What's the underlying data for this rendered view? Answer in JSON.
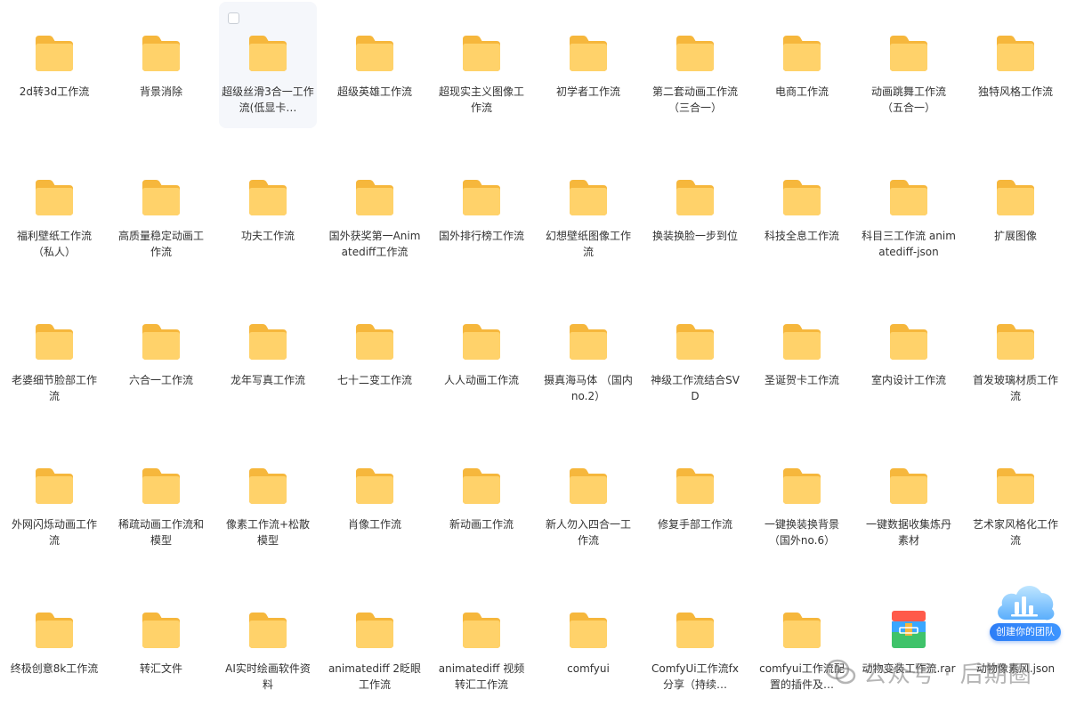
{
  "items": [
    {
      "name": "2d转3d工作流",
      "type": "folder"
    },
    {
      "name": "背景消除",
      "type": "folder"
    },
    {
      "name": "超级丝滑3合一工作流(低显卡…",
      "type": "folder",
      "selected": true
    },
    {
      "name": "超级英雄工作流",
      "type": "folder"
    },
    {
      "name": "超现实主义图像工作流",
      "type": "folder"
    },
    {
      "name": "初学者工作流",
      "type": "folder"
    },
    {
      "name": "第二套动画工作流（三合一）",
      "type": "folder"
    },
    {
      "name": "电商工作流",
      "type": "folder"
    },
    {
      "name": "动画跳舞工作流（五合一）",
      "type": "folder"
    },
    {
      "name": "独特风格工作流",
      "type": "folder"
    },
    {
      "name": "福利壁纸工作流（私人）",
      "type": "folder"
    },
    {
      "name": "高质量稳定动画工作流",
      "type": "folder"
    },
    {
      "name": "功夫工作流",
      "type": "folder"
    },
    {
      "name": "国外获奖第一Animatediff工作流",
      "type": "folder"
    },
    {
      "name": "国外排行榜工作流",
      "type": "folder"
    },
    {
      "name": "幻想壁纸图像工作流",
      "type": "folder"
    },
    {
      "name": "换装换脸一步到位",
      "type": "folder"
    },
    {
      "name": "科技全息工作流",
      "type": "folder"
    },
    {
      "name": "科目三工作流 animatediff-json",
      "type": "folder"
    },
    {
      "name": "扩展图像",
      "type": "folder"
    },
    {
      "name": "老婆细节脸部工作流",
      "type": "folder"
    },
    {
      "name": "六合一工作流",
      "type": "folder"
    },
    {
      "name": "龙年写真工作流",
      "type": "folder"
    },
    {
      "name": "七十二变工作流",
      "type": "folder"
    },
    {
      "name": "人人动画工作流",
      "type": "folder"
    },
    {
      "name": "摄真海马体 （国内no.2）",
      "type": "folder"
    },
    {
      "name": "神级工作流结合SVD",
      "type": "folder"
    },
    {
      "name": "圣诞贺卡工作流",
      "type": "folder"
    },
    {
      "name": "室内设计工作流",
      "type": "folder"
    },
    {
      "name": "首发玻璃材质工作流",
      "type": "folder"
    },
    {
      "name": "外网闪烁动画工作流",
      "type": "folder"
    },
    {
      "name": "稀疏动画工作流和模型",
      "type": "folder"
    },
    {
      "name": "像素工作流+松散模型",
      "type": "folder"
    },
    {
      "name": "肖像工作流",
      "type": "folder"
    },
    {
      "name": "新动画工作流",
      "type": "folder"
    },
    {
      "name": "新人勿入四合一工作流",
      "type": "folder"
    },
    {
      "name": "修复手部工作流",
      "type": "folder"
    },
    {
      "name": "一键换装换背景（国外no.6）",
      "type": "folder"
    },
    {
      "name": "一键数据收集炼丹素材",
      "type": "folder"
    },
    {
      "name": "艺术家风格化工作流",
      "type": "folder"
    },
    {
      "name": "终极创意8k工作流",
      "type": "folder"
    },
    {
      "name": "转汇文件",
      "type": "folder"
    },
    {
      "name": "AI实时绘画软件资料",
      "type": "folder"
    },
    {
      "name": "animatediff 2眨眼工作流",
      "type": "folder"
    },
    {
      "name": "animatediff 视频转汇工作流",
      "type": "folder"
    },
    {
      "name": "comfyui",
      "type": "folder"
    },
    {
      "name": "ComfyUi工作流fx分享（持续…",
      "type": "folder"
    },
    {
      "name": "comfyui工作流配置的插件及…",
      "type": "folder"
    },
    {
      "name": "动物变装工作流.rar",
      "type": "archive"
    },
    {
      "name": "动物像素风.json",
      "type": "file"
    }
  ],
  "team_badge": {
    "label": "创建你的团队"
  },
  "watermark": {
    "text": "公众号 · 后期圈"
  },
  "colors": {
    "folder_back": "#f6b73c",
    "folder_front": "#ffd26a",
    "selected_bg": "#f5f7fb",
    "badge_blue": "#2d7df6"
  }
}
